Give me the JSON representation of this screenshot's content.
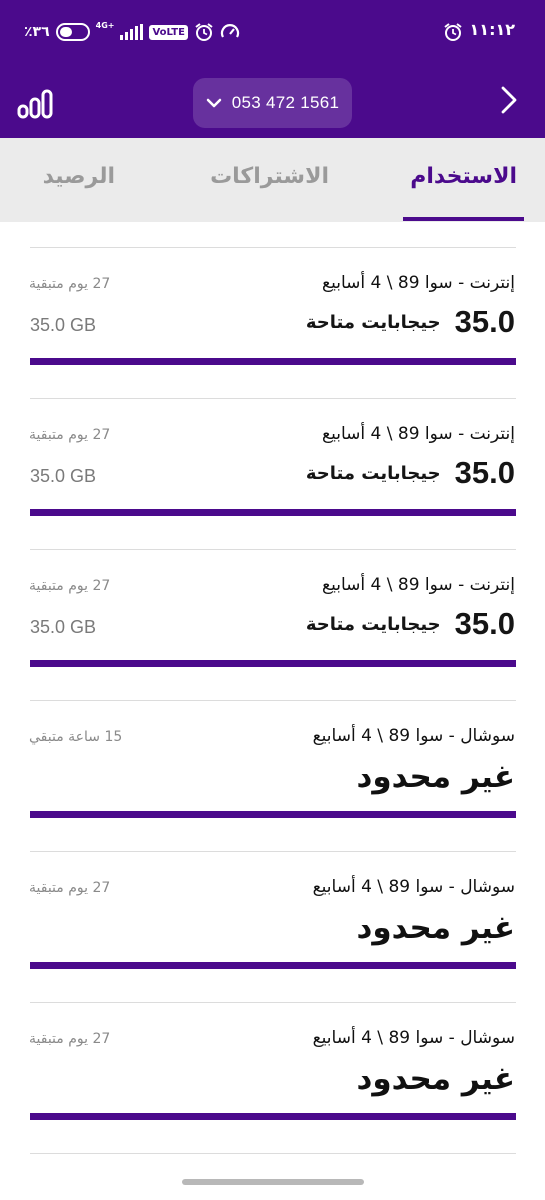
{
  "status_bar": {
    "time": "١١:١٢",
    "battery": "٪٣٦",
    "network": "4G+",
    "volte": "VoLTE"
  },
  "app_bar": {
    "phone_number": "053 472 1561"
  },
  "tabs": [
    {
      "label": "الاستخدام",
      "active": true
    },
    {
      "label": "الاشتراكات",
      "active": false
    },
    {
      "label": "الرصيد",
      "active": false
    }
  ],
  "cards": [
    {
      "title": "إنترنت - سوا 89 \\ 4 أسابيع",
      "remaining": "27 يوم متبقية",
      "amount": "35.0",
      "unit": "جيجابايت متاحة",
      "total": "35.0 GB",
      "fill_percent": 100
    },
    {
      "title": "إنترنت - سوا 89 \\ 4 أسابيع",
      "remaining": "27 يوم متبقية",
      "amount": "35.0",
      "unit": "جيجابايت متاحة",
      "total": "35.0 GB",
      "fill_percent": 100
    },
    {
      "title": "إنترنت - سوا 89 \\ 4 أسابيع",
      "remaining": "27 يوم متبقية",
      "amount": "35.0",
      "unit": "جيجابايت متاحة",
      "total": "35.0 GB",
      "fill_percent": 100
    },
    {
      "title": "سوشال - سوا 89 \\ 4 أسابيع",
      "remaining": "15 ساعة متبقي",
      "unlimited": "غير محدود",
      "fill_percent": 100
    },
    {
      "title": "سوشال - سوا 89 \\ 4 أسابيع",
      "remaining": "27 يوم متبقية",
      "unlimited": "غير محدود",
      "fill_percent": 100
    },
    {
      "title": "سوشال - سوا 89 \\ 4 أسابيع",
      "remaining": "27 يوم متبقية",
      "unlimited": "غير محدود",
      "fill_percent": 100
    }
  ],
  "colors": {
    "brand_purple": "#4b0a8c",
    "tab_background": "#ebebeb",
    "inactive_tab": "#9a9a9a"
  },
  "icons": {
    "back": "chevron-right-icon",
    "stats": "bar-chart-icon",
    "dropdown": "chevron-down-icon"
  }
}
